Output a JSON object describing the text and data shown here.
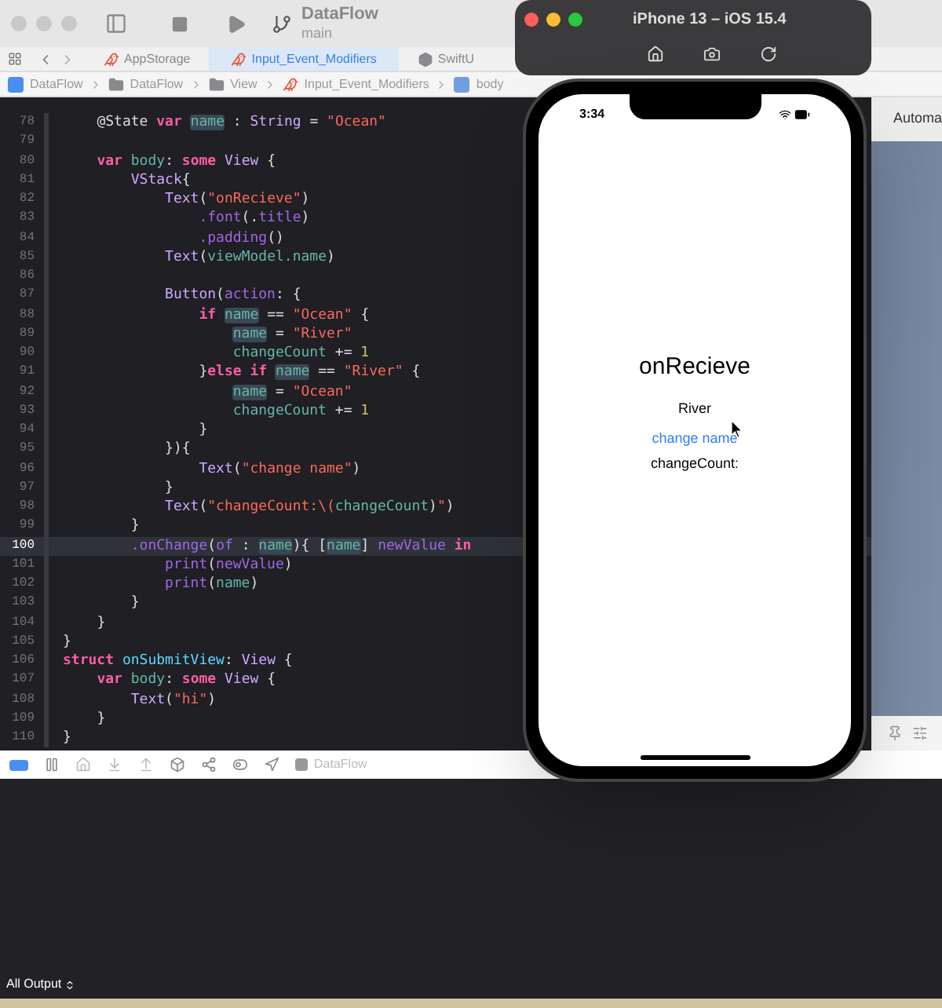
{
  "scheme": {
    "title": "DataFlow",
    "branch": "main"
  },
  "tabs": [
    {
      "label": "AppStorage",
      "selected": false,
      "kind": "swift"
    },
    {
      "label": "Input_Event_Modifiers",
      "selected": true,
      "kind": "swift"
    },
    {
      "label": "SwiftU",
      "selected": false,
      "kind": "module"
    }
  ],
  "breadcrumb": [
    {
      "label": "DataFlow",
      "kind": "project"
    },
    {
      "label": "DataFlow",
      "kind": "folder"
    },
    {
      "label": "View",
      "kind": "folder"
    },
    {
      "label": "Input_Event_Modifiers",
      "kind": "swift"
    },
    {
      "label": "body",
      "kind": "property"
    }
  ],
  "editor": {
    "lines": [
      {
        "number": "78",
        "current": false,
        "tokens": [
          {
            "text": "    @State ",
            "kind": "plain"
          },
          {
            "text": "var ",
            "kind": "keyword"
          },
          {
            "text": "name",
            "kind": "highlight"
          },
          {
            "text": " : ",
            "kind": "plain"
          },
          {
            "text": "String",
            "kind": "type"
          },
          {
            "text": " = ",
            "kind": "plain"
          },
          {
            "text": "\"Ocean\"",
            "kind": "string"
          }
        ]
      },
      {
        "number": "79",
        "current": false
      },
      {
        "number": "80",
        "current": false,
        "tokens": [
          {
            "text": "    var ",
            "kind": "keyword"
          },
          {
            "text": "body",
            "kind": "property"
          },
          {
            "text": ": ",
            "kind": "plain"
          },
          {
            "text": "some ",
            "kind": "keyword"
          },
          {
            "text": "View",
            "kind": "type"
          },
          {
            "text": " {",
            "kind": "plain"
          }
        ]
      },
      {
        "number": "81",
        "current": false,
        "tokens": [
          {
            "text": "        VStack",
            "kind": "type"
          },
          {
            "text": "{",
            "kind": "plain"
          }
        ]
      },
      {
        "number": "82",
        "current": false,
        "tokens": [
          {
            "text": "            Text",
            "kind": "type"
          },
          {
            "text": "(",
            "kind": "plain"
          },
          {
            "text": "\"onRecieve\"",
            "kind": "string"
          },
          {
            "text": ")",
            "kind": "plain"
          }
        ]
      },
      {
        "number": "83",
        "current": false,
        "tokens": [
          {
            "text": "                .font",
            "kind": "function"
          },
          {
            "text": "(.",
            "kind": "plain"
          },
          {
            "text": "title",
            "kind": "function"
          },
          {
            "text": ")",
            "kind": "plain"
          }
        ]
      },
      {
        "number": "84",
        "current": false,
        "tokens": [
          {
            "text": "                .padding",
            "kind": "function"
          },
          {
            "text": "()",
            "kind": "plain"
          }
        ]
      },
      {
        "number": "85",
        "current": false,
        "tokens": [
          {
            "text": "            Text",
            "kind": "type"
          },
          {
            "text": "(",
            "kind": "plain"
          },
          {
            "text": "viewModel.name",
            "kind": "property"
          },
          {
            "text": ")",
            "kind": "plain"
          }
        ]
      },
      {
        "number": "86",
        "current": false
      },
      {
        "number": "87",
        "current": false,
        "tokens": [
          {
            "text": "            Button",
            "kind": "type"
          },
          {
            "text": "(",
            "kind": "plain"
          },
          {
            "text": "action",
            "kind": "function"
          },
          {
            "text": ": {",
            "kind": "plain"
          }
        ]
      },
      {
        "number": "88",
        "current": false,
        "tokens": [
          {
            "text": "                if ",
            "kind": "keyword"
          },
          {
            "text": "name",
            "kind": "highlight"
          },
          {
            "text": " == ",
            "kind": "plain"
          },
          {
            "text": "\"Ocean\"",
            "kind": "string"
          },
          {
            "text": " {",
            "kind": "plain"
          }
        ]
      },
      {
        "number": "89",
        "current": false,
        "tokens": [
          {
            "text": "                    name",
            "kind": "highlight"
          },
          {
            "text": " = ",
            "kind": "plain"
          },
          {
            "text": "\"River\"",
            "kind": "string"
          }
        ]
      },
      {
        "number": "90",
        "current": false,
        "tokens": [
          {
            "text": "                    changeCount",
            "kind": "property"
          },
          {
            "text": " += ",
            "kind": "plain"
          },
          {
            "text": "1",
            "kind": "number"
          }
        ]
      },
      {
        "number": "91",
        "current": false,
        "tokens": [
          {
            "text": "                }",
            "kind": "plain"
          },
          {
            "text": "else if ",
            "kind": "keyword"
          },
          {
            "text": "name",
            "kind": "highlight"
          },
          {
            "text": " == ",
            "kind": "plain"
          },
          {
            "text": "\"River\"",
            "kind": "string"
          },
          {
            "text": " {",
            "kind": "plain"
          }
        ]
      },
      {
        "number": "92",
        "current": false,
        "tokens": [
          {
            "text": "                    name",
            "kind": "highlight"
          },
          {
            "text": " = ",
            "kind": "plain"
          },
          {
            "text": "\"Ocean\"",
            "kind": "string"
          }
        ]
      },
      {
        "number": "93",
        "current": false,
        "tokens": [
          {
            "text": "                    changeCount",
            "kind": "property"
          },
          {
            "text": " += ",
            "kind": "plain"
          },
          {
            "text": "1",
            "kind": "number"
          }
        ]
      },
      {
        "number": "94",
        "current": false,
        "tokens": [
          {
            "text": "                }",
            "kind": "plain"
          }
        ]
      },
      {
        "number": "95",
        "current": false,
        "tokens": [
          {
            "text": "            }){",
            "kind": "plain"
          }
        ]
      },
      {
        "number": "96",
        "current": false,
        "tokens": [
          {
            "text": "                Text",
            "kind": "type"
          },
          {
            "text": "(",
            "kind": "plain"
          },
          {
            "text": "\"change name\"",
            "kind": "string"
          },
          {
            "text": ")",
            "kind": "plain"
          }
        ]
      },
      {
        "number": "97",
        "current": false,
        "tokens": [
          {
            "text": "            }",
            "kind": "plain"
          }
        ]
      },
      {
        "number": "98",
        "current": false,
        "tokens": [
          {
            "text": "            Text",
            "kind": "type"
          },
          {
            "text": "(",
            "kind": "plain"
          },
          {
            "text": "\"changeCount:\\(",
            "kind": "string"
          },
          {
            "text": "changeCount",
            "kind": "property"
          },
          {
            "text": ")",
            "kind": "plain"
          },
          {
            "text": "\"",
            "kind": "string"
          },
          {
            "text": ")",
            "kind": "plain"
          }
        ]
      },
      {
        "number": "99",
        "current": false,
        "tokens": [
          {
            "text": "        }",
            "kind": "plain"
          }
        ]
      },
      {
        "number": "100",
        "current": true,
        "tokens": [
          {
            "text": "        .onChange",
            "kind": "function"
          },
          {
            "text": "(",
            "kind": "plain"
          },
          {
            "text": "of",
            "kind": "function"
          },
          {
            "text": " : ",
            "kind": "plain"
          },
          {
            "text": "name",
            "kind": "highlight"
          },
          {
            "text": "){ [",
            "kind": "plain"
          },
          {
            "text": "name",
            "kind": "highlight"
          },
          {
            "text": "] ",
            "kind": "plain"
          },
          {
            "text": "newValue ",
            "kind": "function"
          },
          {
            "text": "in",
            "kind": "keyword"
          }
        ]
      },
      {
        "number": "101",
        "current": false,
        "tokens": [
          {
            "text": "            print",
            "kind": "function"
          },
          {
            "text": "(",
            "kind": "plain"
          },
          {
            "text": "newValue",
            "kind": "function"
          },
          {
            "text": ")",
            "kind": "plain"
          }
        ]
      },
      {
        "number": "102",
        "current": false,
        "tokens": [
          {
            "text": "            print",
            "kind": "function"
          },
          {
            "text": "(",
            "kind": "plain"
          },
          {
            "text": "name",
            "kind": "property"
          },
          {
            "text": ")",
            "kind": "plain"
          }
        ]
      },
      {
        "number": "103",
        "current": false,
        "tokens": [
          {
            "text": "        }",
            "kind": "plain"
          }
        ]
      },
      {
        "number": "104",
        "current": false,
        "tokens": [
          {
            "text": "    }",
            "kind": "plain"
          }
        ]
      },
      {
        "number": "105",
        "current": false,
        "tokens": [
          {
            "text": "}",
            "kind": "plain"
          }
        ]
      },
      {
        "number": "106",
        "current": false,
        "tokens": [
          {
            "text": "struct ",
            "kind": "keyword"
          },
          {
            "text": "onSubmitView",
            "kind": "declaration"
          },
          {
            "text": ": ",
            "kind": "plain"
          },
          {
            "text": "View",
            "kind": "type"
          },
          {
            "text": " {",
            "kind": "plain"
          }
        ]
      },
      {
        "number": "107",
        "current": false,
        "tokens": [
          {
            "text": "    var ",
            "kind": "keyword"
          },
          {
            "text": "body",
            "kind": "property"
          },
          {
            "text": ": ",
            "kind": "plain"
          },
          {
            "text": "some ",
            "kind": "keyword"
          },
          {
            "text": "View",
            "kind": "type"
          },
          {
            "text": " {",
            "kind": "plain"
          }
        ]
      },
      {
        "number": "108",
        "current": false,
        "tokens": [
          {
            "text": "        Text",
            "kind": "type"
          },
          {
            "text": "(",
            "kind": "plain"
          },
          {
            "text": "\"hi\"",
            "kind": "string"
          },
          {
            "text": ")",
            "kind": "plain"
          }
        ]
      },
      {
        "number": "109",
        "current": false,
        "tokens": [
          {
            "text": "    }",
            "kind": "plain"
          }
        ]
      },
      {
        "number": "110",
        "current": false,
        "tokens": [
          {
            "text": "}",
            "kind": "plain"
          }
        ]
      }
    ]
  },
  "inspector": {
    "title": "Automa"
  },
  "debug_bar": {
    "target": "DataFlow"
  },
  "console": {
    "filter": "All Output"
  },
  "simulator": {
    "title": "iPhone 13 – iOS 15.4",
    "time": "3:34",
    "content": [
      {
        "kind": "title",
        "text": "onRecieve"
      },
      {
        "kind": "text",
        "text": "River"
      },
      {
        "kind": "link",
        "text": "change name"
      },
      {
        "kind": "text",
        "text": "changeCount:"
      }
    ]
  }
}
